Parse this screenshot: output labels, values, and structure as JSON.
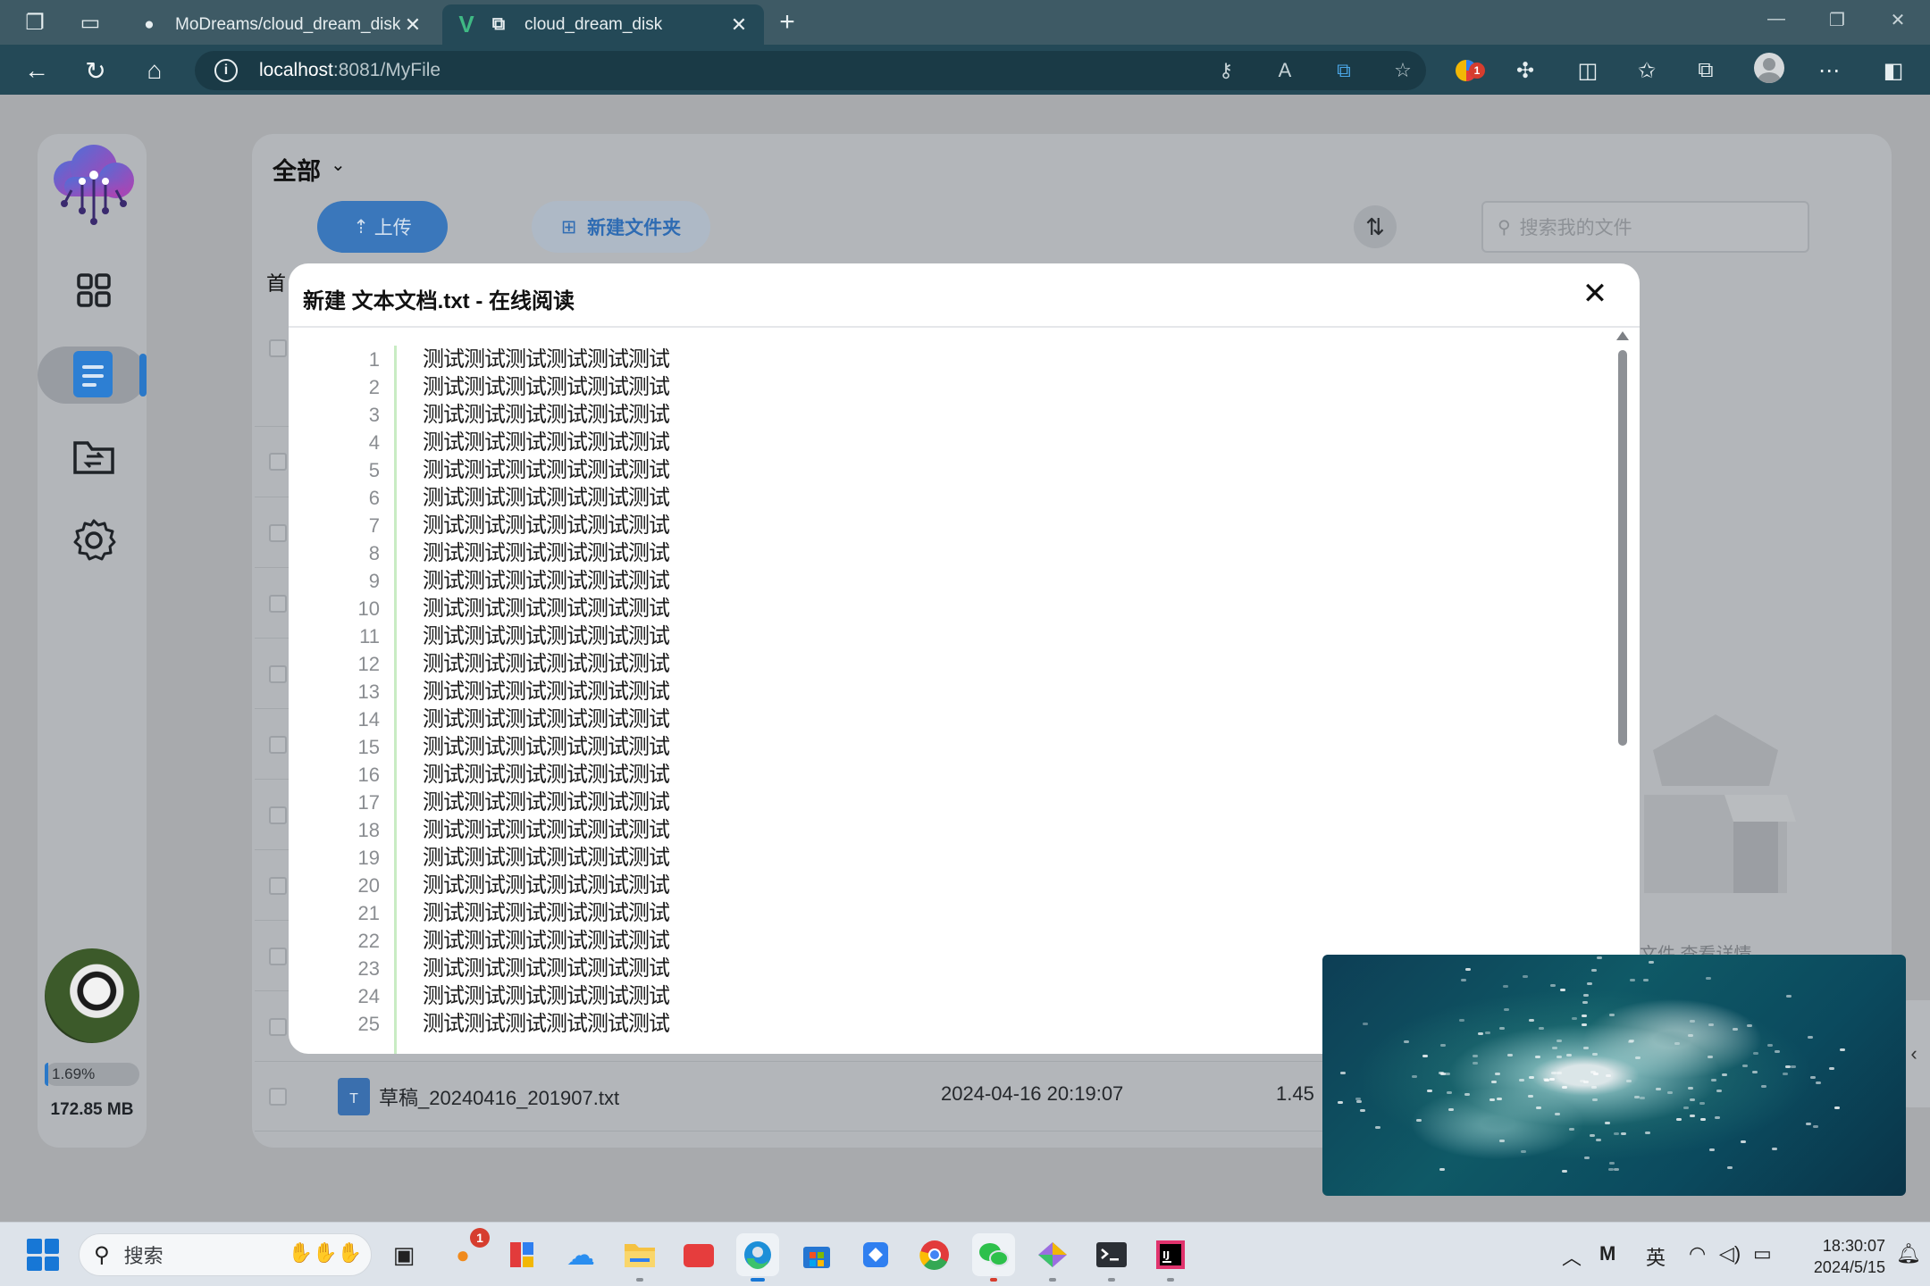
{
  "browser": {
    "tabs": [
      {
        "title": "MoDreams/cloud_dream_disk: —",
        "icon": "github-icon",
        "active": false
      },
      {
        "title": "cloud_dream_disk",
        "icon": "vue-icon",
        "active": true
      }
    ],
    "url_host": "localhost",
    "url_rest": ":8081/MyFile",
    "extension_badge": "1"
  },
  "sidebar": {
    "usage_percent_label": "1.69%",
    "usage_fraction": 0.0169,
    "storage_used": "172.85 MB"
  },
  "main": {
    "scope_label": "全部",
    "upload_label": "上传",
    "new_folder_label": "新建文件夹",
    "search_placeholder": "搜索我的文件",
    "breadcrumb_label": "首",
    "visible_file": {
      "name": "草稿_20240416_201907.txt",
      "date": "2024-04-16 20:19:07",
      "size": "1.45",
      "type_letter": "T"
    },
    "empty_hint": "文件  查看详情"
  },
  "modal": {
    "title": "新建 文本文档.txt - 在线阅读",
    "lines": [
      {
        "n": "1",
        "text": "测试测试测试测试测试测试"
      },
      {
        "n": "2",
        "text": "测试测试测试测试测试测试"
      },
      {
        "n": "3",
        "text": "测试测试测试测试测试测试"
      },
      {
        "n": "4",
        "text": "测试测试测试测试测试测试"
      },
      {
        "n": "5",
        "text": "测试测试测试测试测试测试"
      },
      {
        "n": "6",
        "text": "测试测试测试测试测试测试"
      },
      {
        "n": "7",
        "text": "测试测试测试测试测试测试"
      },
      {
        "n": "8",
        "text": "测试测试测试测试测试测试"
      },
      {
        "n": "9",
        "text": "测试测试测试测试测试测试"
      },
      {
        "n": "10",
        "text": "测试测试测试测试测试测试"
      },
      {
        "n": "11",
        "text": "测试测试测试测试测试测试"
      },
      {
        "n": "12",
        "text": "测试测试测试测试测试测试"
      },
      {
        "n": "13",
        "text": "测试测试测试测试测试测试"
      },
      {
        "n": "14",
        "text": "测试测试测试测试测试测试"
      },
      {
        "n": "15",
        "text": "测试测试测试测试测试测试"
      },
      {
        "n": "16",
        "text": "测试测试测试测试测试测试"
      },
      {
        "n": "17",
        "text": "测试测试测试测试测试测试"
      },
      {
        "n": "18",
        "text": "测试测试测试测试测试测试"
      },
      {
        "n": "19",
        "text": "测试测试测试测试测试测试"
      },
      {
        "n": "20",
        "text": "测试测试测试测试测试测试"
      },
      {
        "n": "21",
        "text": "测试测试测试测试测试测试"
      },
      {
        "n": "22",
        "text": "测试测试测试测试测试测试"
      },
      {
        "n": "23",
        "text": "测试测试测试测试测试测试"
      },
      {
        "n": "24",
        "text": "测试测试测试测试测试测试"
      },
      {
        "n": "25",
        "text": "测试测试测试测试测试测试"
      }
    ]
  },
  "taskbar": {
    "search_label": "搜索",
    "ime_label": "英",
    "time": "18:30:07",
    "date": "2024/5/15",
    "notification_badge": "1"
  },
  "colors": {
    "accent": "#2a78c8",
    "browser_tabbar": "#3e5a65",
    "browser_toolbar": "#244957",
    "gutter": "#c9ecc3"
  }
}
